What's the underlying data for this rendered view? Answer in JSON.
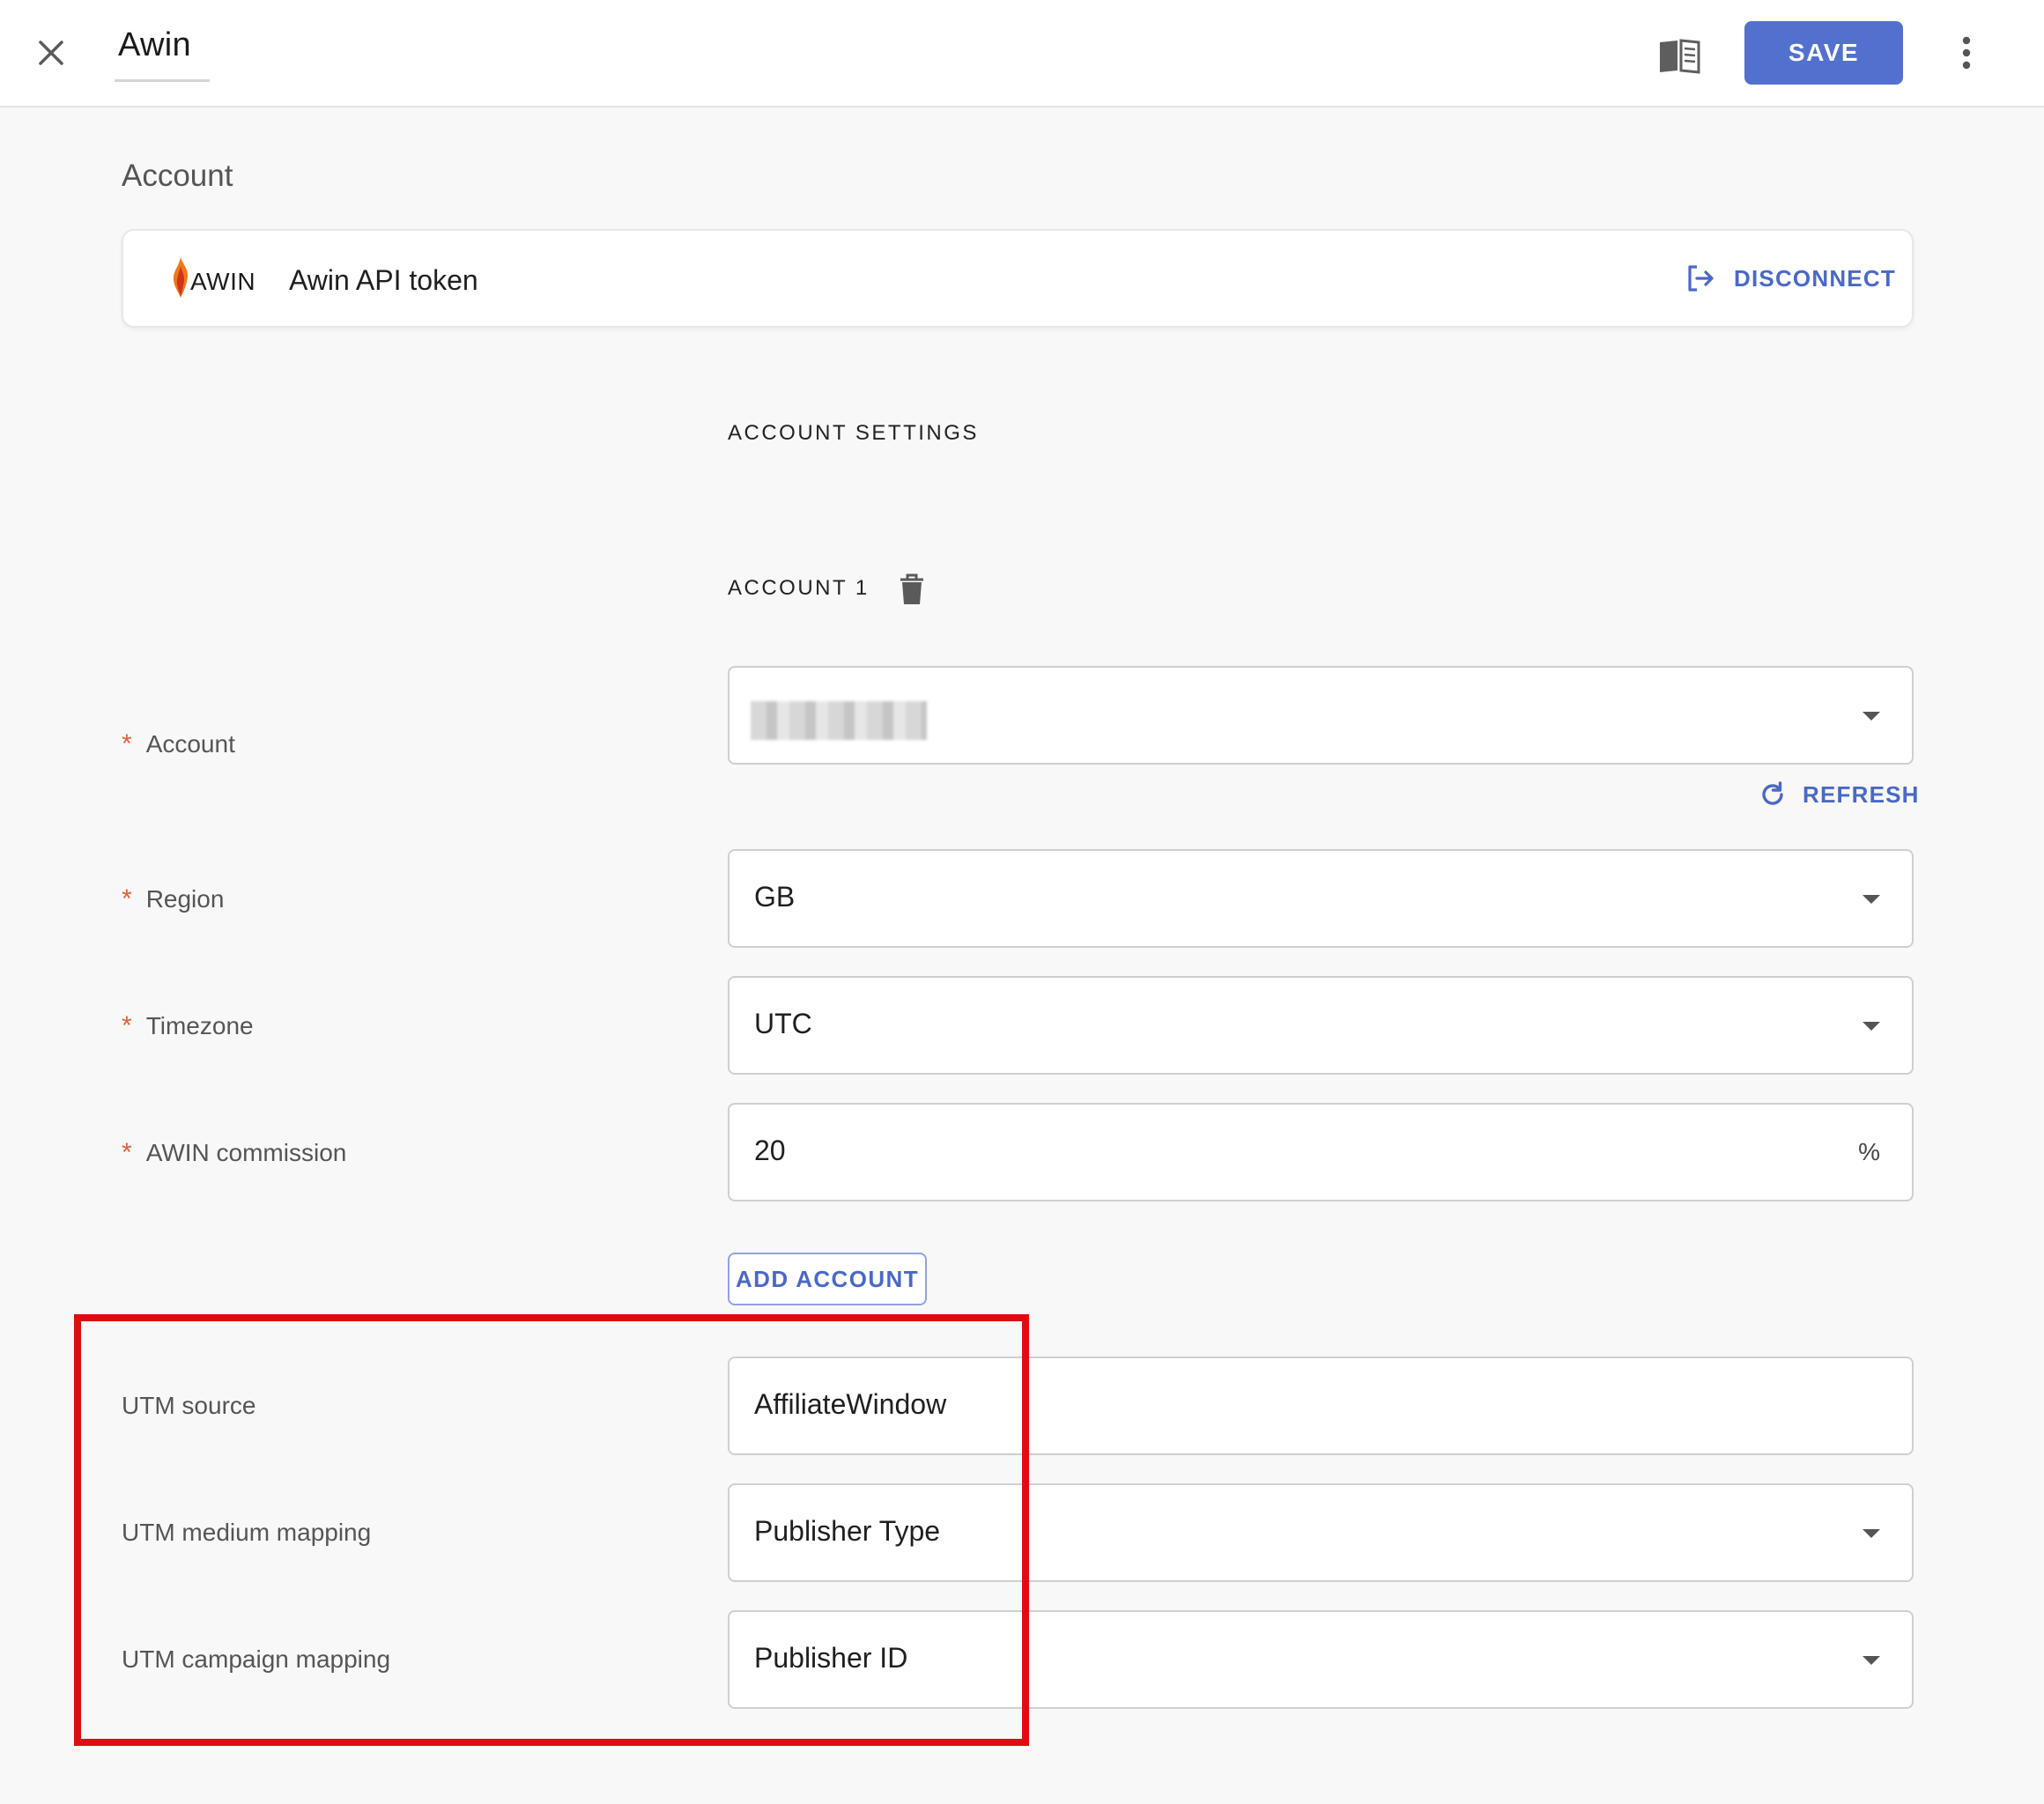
{
  "header": {
    "title": "Awin",
    "save_label": "SAVE",
    "icons": {
      "close": "close-icon",
      "docs": "book-icon",
      "more": "more-vertical-icon"
    },
    "accent_color": "#5271cf"
  },
  "account_section": {
    "title": "Account",
    "connection": {
      "logo_text": "AWIN",
      "token_label": "Awin API token",
      "disconnect_label": "DISCONNECT"
    }
  },
  "settings": {
    "heading": "ACCOUNT SETTINGS",
    "account_heading": "ACCOUNT 1",
    "fields": {
      "account": {
        "label": "Account",
        "required": true,
        "value": ""
      },
      "refresh_label": "REFRESH",
      "region": {
        "label": "Region",
        "required": true,
        "value": "GB"
      },
      "timezone": {
        "label": "Timezone",
        "required": true,
        "value": "UTC"
      },
      "commission": {
        "label": "AWIN commission",
        "required": true,
        "value": "20",
        "suffix": "%"
      }
    },
    "add_account_label": "ADD ACCOUNT"
  },
  "utm": {
    "source": {
      "label": "UTM source",
      "value": "AffiliateWindow"
    },
    "medium": {
      "label": "UTM medium mapping",
      "value": "Publisher Type"
    },
    "campaign": {
      "label": "UTM campaign mapping",
      "value": "Publisher ID"
    },
    "highlight_color": "#dd0d12"
  },
  "required_marker": "*"
}
